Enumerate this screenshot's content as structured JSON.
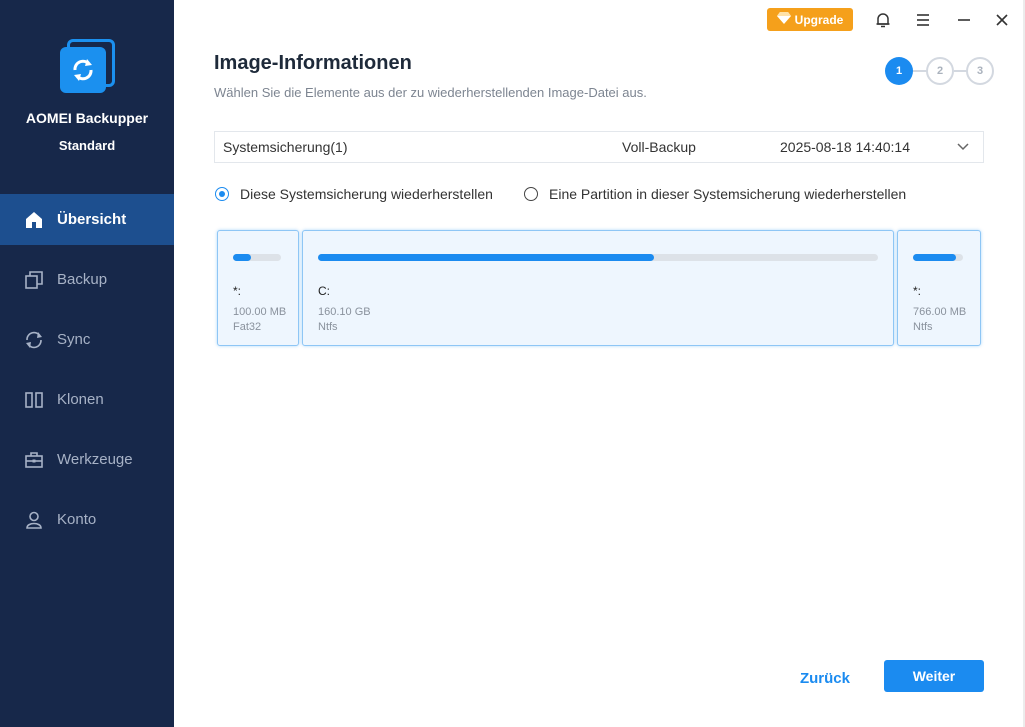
{
  "app": {
    "name": "AOMEI Backupper",
    "edition": "Standard"
  },
  "sidebar": {
    "items": [
      {
        "label": "Übersicht",
        "icon": "home-icon",
        "active": true
      },
      {
        "label": "Backup",
        "icon": "backup-icon",
        "active": false
      },
      {
        "label": "Sync",
        "icon": "sync-icon",
        "active": false
      },
      {
        "label": "Klonen",
        "icon": "clone-icon",
        "active": false
      },
      {
        "label": "Werkzeuge",
        "icon": "toolbox-icon",
        "active": false
      },
      {
        "label": "Konto",
        "icon": "user-icon",
        "active": false
      }
    ]
  },
  "titlebar": {
    "upgrade_label": "Upgrade",
    "icons": [
      "bell-icon",
      "menu-icon",
      "minimize-icon",
      "close-icon"
    ]
  },
  "page": {
    "title": "Image-Informationen",
    "subtitle": "Wählen Sie die Elemente aus der zu wiederherstellenden Image-Datei aus."
  },
  "stepper": {
    "steps": [
      "1",
      "2",
      "3"
    ],
    "current": 1
  },
  "backup": {
    "name": "Systemsicherung(1)",
    "type": "Voll-Backup",
    "date": "2025-08-18 14:40:14"
  },
  "options": {
    "restore_system": "Diese Systemsicherung wiederherstellen",
    "restore_partition": "Eine Partition in dieser Systemsicherung wiederherstellen",
    "selected": "restore_system"
  },
  "partitions": [
    {
      "letter": "*:",
      "size": "100.00 MB",
      "fs": "Fat32",
      "used_fraction": 0.38
    },
    {
      "letter": "C:",
      "size": "160.10 GB",
      "fs": "Ntfs",
      "used_fraction": 0.6
    },
    {
      "letter": "*:",
      "size": "766.00 MB",
      "fs": "Ntfs",
      "used_fraction": 0.85
    }
  ],
  "footer": {
    "back_label": "Zurück",
    "next_label": "Weiter"
  },
  "colors": {
    "accent": "#1b8bf0",
    "sidebar_bg": "#17284a",
    "sidebar_active": "#1d4f8f",
    "upgrade": "#f5a01b"
  }
}
